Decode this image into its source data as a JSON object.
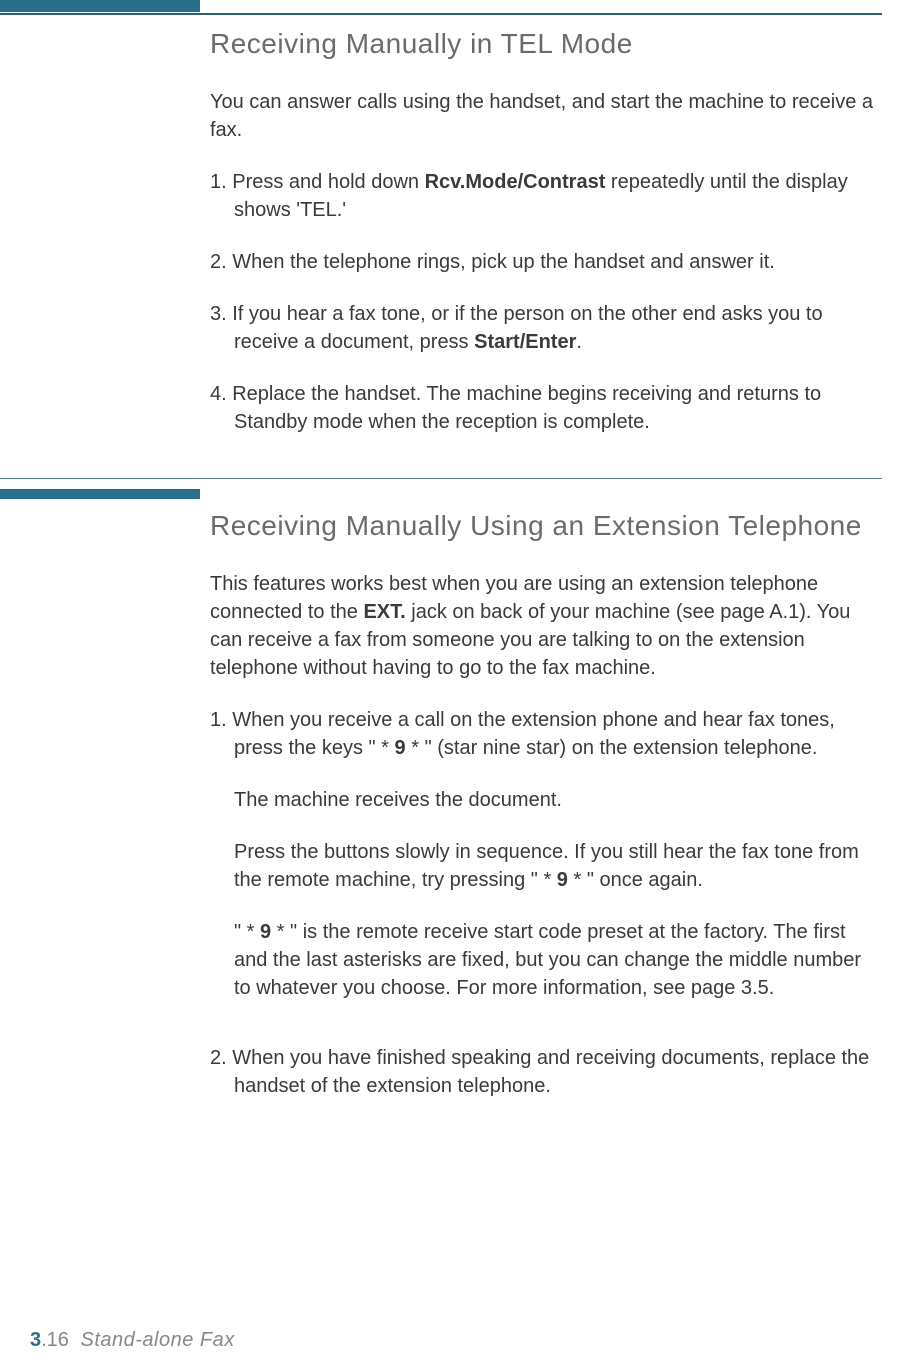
{
  "section1": {
    "heading": "Receiving Manually in TEL Mode",
    "intro": "You can answer calls using the handset, and start the machine to receive a fax.",
    "step1_a": "1. Press and hold down ",
    "step1_bold": "Rcv.Mode/Contrast",
    "step1_b": " repeatedly until the display shows 'TEL.'",
    "step2": "2. When the telephone rings, pick up the handset and answer it.",
    "step3_a": "3. If you hear a fax tone, or if the person on the other end asks you to receive a document, press ",
    "step3_bold": "Start/Enter",
    "step3_b": ".",
    "step4": "4. Replace the handset. The machine begins receiving and returns to Standby mode when the reception is complete."
  },
  "section2": {
    "heading": "Receiving Manually Using an Extension Telephone",
    "intro_a": "This features works best when you are using an extension telephone connected to the ",
    "intro_bold": "EXT.",
    "intro_b": " jack on back of your machine (see page A.1). You can receive a fax from someone you are talking to on the extension telephone without having to go to the fax machine.",
    "step1_a": "1. When you receive a call on the extension phone and hear fax tones, press the keys \" ",
    "star1": "*",
    "nine1": " 9 ",
    "star2": "*",
    "step1_b": " \" (star nine star) on the extension telephone.",
    "sub1": "The machine receives the document.",
    "sub2_a": "Press the buttons slowly in sequence. If you still hear the fax tone from the remote machine, try pressing \" ",
    "sub2_star1": "*",
    "sub2_nine": " 9 ",
    "sub2_star2": "*",
    "sub2_b": " \" once again.",
    "sub3_a": "\" ",
    "sub3_star1": "*",
    "sub3_nine": " 9 ",
    "sub3_star2": "*",
    "sub3_b": " \" is the remote receive start code preset at the factory. The first and the last asterisks are fixed, but you can change the middle number to whatever you choose. For more information, see page 3.5.",
    "step2": "2. When you have finished speaking and receiving documents, replace the handset of the extension telephone."
  },
  "footer": {
    "chapter": "3",
    "page": ".16",
    "title": "Stand-alone Fax"
  }
}
